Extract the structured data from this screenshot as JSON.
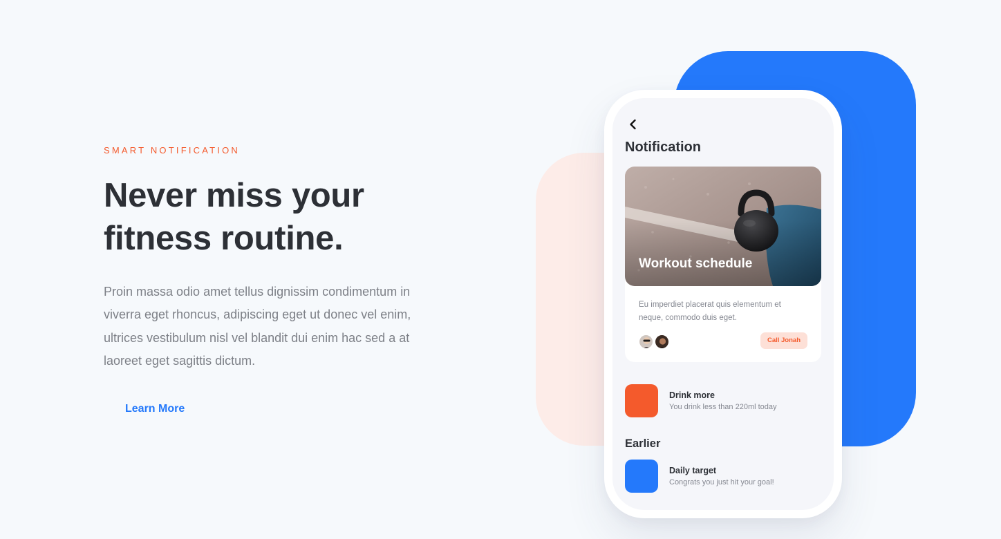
{
  "colors": {
    "accent_orange": "#f45a2c",
    "accent_blue": "#2479fb",
    "pink_shape": "#fdece8",
    "call_button_bg": "#fde0d7",
    "call_button_text": "#f45a2c",
    "learn_more": "#2479fb"
  },
  "hero": {
    "eyebrow": "SMART NOTIFICATION",
    "headline": "Never miss your fitness routine.",
    "body": "Proin massa odio amet tellus dignissim condimentum in viverra eget rhoncus, adipiscing eget ut donec vel enim, ultrices vestibulum nisl vel blandit dui enim hac sed a at laoreet eget sagittis dictum.",
    "cta_label": "Learn More"
  },
  "phone": {
    "back_icon": "chevron-left-icon",
    "title": "Notification",
    "card": {
      "photo_title": "Workout schedule",
      "description": "Eu imperdiet placerat quis elementum et neque, commodo duis eget.",
      "button_label": "Call Jonah"
    },
    "notifications": [
      {
        "title": "Drink more",
        "subtitle": "You drink less than 220ml today",
        "color": "#f45a2c"
      }
    ],
    "earlier_label": "Earlier",
    "earlier": [
      {
        "title": "Daily target",
        "subtitle": "Congrats you just hit your goal!",
        "color": "#2479fb"
      }
    ]
  }
}
